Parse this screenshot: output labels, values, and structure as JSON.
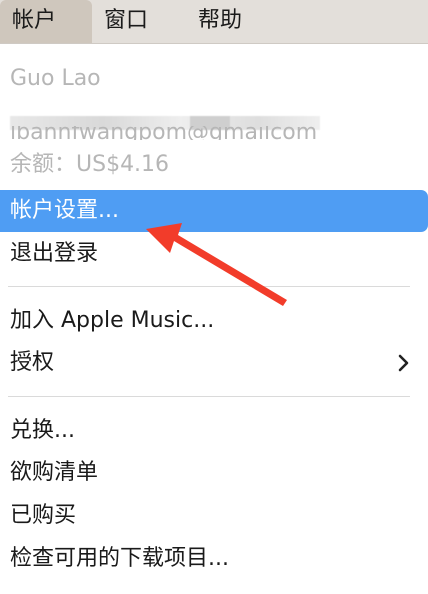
{
  "menubar": {
    "items": [
      {
        "label": "帐户",
        "active": true
      },
      {
        "label": "窗口",
        "active": false
      },
      {
        "label": "帮助",
        "active": false
      }
    ]
  },
  "account": {
    "name": "Guo Lao",
    "email_partial": "lbannfwangpom@gmailcom",
    "balance": "余额：US$4.16"
  },
  "menu": {
    "account_settings": "帐户设置...",
    "sign_out": "退出登录",
    "join_apple_music": "加入 Apple Music...",
    "authorize": "授权",
    "redeem": "兑换...",
    "wishlist": "欲购清单",
    "purchased": "已购买",
    "check_downloads": "检查可用的下载项目..."
  },
  "colors": {
    "highlight": "#4f9df3",
    "arrow": "#f23c2a",
    "menubar": "#e3dfda"
  },
  "icons": {
    "submenu": "chevron-right-icon",
    "annotation": "red-arrow"
  }
}
